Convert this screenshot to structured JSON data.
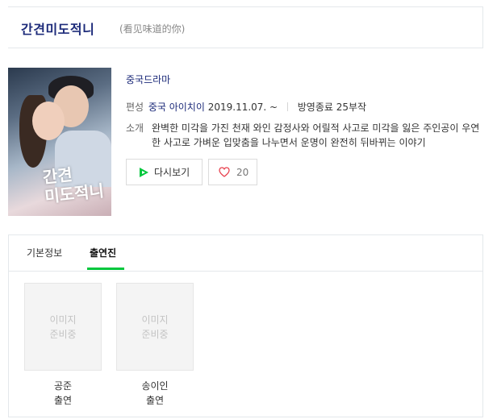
{
  "header": {
    "title": "간견미도적니",
    "subtitle": "(看见味道的你)"
  },
  "poster": {
    "title_text": "간견미도적니",
    "line1": "간견",
    "line2": "미도적니"
  },
  "info": {
    "genre": "중국드라마",
    "broadcast_label": "편성",
    "broadcaster": "중국 아이치이",
    "date": "2019.11.07. ~",
    "status": "방영종료 25부작",
    "synopsis_label": "소개",
    "synopsis": "완벽한 미각을 가진 천재 와인 감정사와 어릴적 사고로 미각을 잃은 주인공이 우연한 사고로 가벼운 입맞춤을 나누면서 운명이 완전히 뒤바뀌는 이야기"
  },
  "actions": {
    "rewatch_label": "다시보기",
    "like_count": "20"
  },
  "tabs": [
    {
      "label": "기본정보",
      "active": false
    },
    {
      "label": "출연진",
      "active": true
    }
  ],
  "cast": [
    {
      "placeholder_line1": "이미지",
      "placeholder_line2": "준비중",
      "name": "공준",
      "role": "출연"
    },
    {
      "placeholder_line1": "이미지",
      "placeholder_line2": "준비중",
      "name": "송이인",
      "role": "출연"
    }
  ],
  "colors": {
    "title": "#1d2b7a",
    "accent_green": "#00c73c",
    "heart": "#e8424f"
  },
  "icons": {
    "rewatch": "play-icon",
    "like": "heart-icon"
  }
}
